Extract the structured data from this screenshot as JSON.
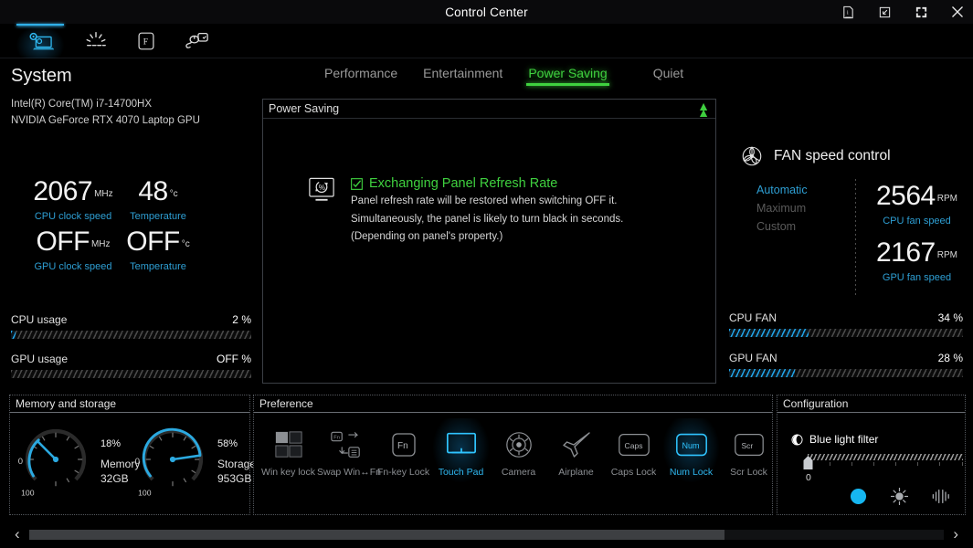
{
  "titlebar": {
    "title": "Control Center",
    "buttons": [
      {
        "name": "info-icon",
        "label": "Info"
      },
      {
        "name": "minimize-to-tray-icon",
        "label": "Minimize"
      },
      {
        "name": "fullscreen-icon",
        "label": "Fullscreen"
      },
      {
        "name": "close-icon",
        "label": "Close"
      }
    ]
  },
  "nav": {
    "items": [
      {
        "name": "system-settings-icon",
        "label": "System",
        "active": true
      },
      {
        "name": "keyboard-backlight-icon",
        "label": "Lighting",
        "active": false
      },
      {
        "name": "fn-key-icon",
        "label": "Fn Key",
        "active": false
      },
      {
        "name": "mouse-device-icon",
        "label": "Device",
        "active": false
      }
    ]
  },
  "system": {
    "title": "System",
    "cpu_name": "Intel(R) Core(TM) i7-14700HX",
    "gpu_name": "NVIDIA GeForce RTX 4070 Laptop GPU",
    "stats": [
      {
        "value": "2067",
        "unit": "MHz",
        "label": "CPU clock speed"
      },
      {
        "value": "48",
        "unit": "°c",
        "label": "Temperature"
      },
      {
        "value": "OFF",
        "unit": "MHz",
        "label": "GPU clock speed"
      },
      {
        "value": "OFF",
        "unit": "°c",
        "label": "Temperature"
      }
    ],
    "usage": [
      {
        "label": "CPU usage",
        "value": "2",
        "unit": "%",
        "percent": 2
      },
      {
        "label": "GPU usage",
        "value": "OFF",
        "unit": "%",
        "percent": 0
      }
    ]
  },
  "modes": {
    "tabs": [
      {
        "label": "Performance",
        "active": false
      },
      {
        "label": "Entertainment",
        "active": false
      },
      {
        "label": "Power Saving",
        "active": true
      },
      {
        "label": "Quiet",
        "active": false
      }
    ],
    "active_color": "#3fd13f"
  },
  "power_saving_panel": {
    "header": "Power Saving",
    "collapse_icon": "chevron-up-double-icon",
    "feature": {
      "icon": "panel-refresh-rate-icon",
      "checkbox": "checked",
      "title": "Exchanging Panel Refresh Rate",
      "description_lines": [
        "Panel refresh rate will be restored when switching OFF it.",
        "Simultaneously, the panel is likely to turn black in seconds.",
        "(Depending on panel's property.)"
      ]
    }
  },
  "fan": {
    "title": "FAN speed control",
    "icon": "fan-icon",
    "modes": [
      {
        "label": "Automatic",
        "selected": true
      },
      {
        "label": "Maximum",
        "selected": false
      },
      {
        "label": "Custom",
        "selected": false
      }
    ],
    "readouts": [
      {
        "value": "2564",
        "unit": "RPM",
        "label": "CPU fan speed"
      },
      {
        "value": "2167",
        "unit": "RPM",
        "label": "GPU fan speed"
      }
    ],
    "bars": [
      {
        "label": "CPU FAN",
        "value": "34",
        "unit": "%",
        "percent": 34
      },
      {
        "label": "GPU FAN",
        "value": "28",
        "unit": "%",
        "percent": 28
      }
    ]
  },
  "memory_storage": {
    "header": "Memory and storage",
    "gauges": [
      {
        "percent": 18,
        "pct_text": "18",
        "pct_unit": "%",
        "name": "Memory",
        "capacity": "32GB",
        "min_label": "0",
        "max_label": "100"
      },
      {
        "percent": 58,
        "pct_text": "58",
        "pct_unit": "%",
        "name": "Storage",
        "capacity": "953GB",
        "min_label": "0",
        "max_label": "100"
      }
    ]
  },
  "preference": {
    "header": "Preference",
    "items": [
      {
        "label": "Win key lock",
        "icon": "win-key-lock-icon",
        "active": false
      },
      {
        "label": "Swap Win↔Fn",
        "icon": "swap-win-fn-icon",
        "active": false
      },
      {
        "label": "Fn-key Lock",
        "icon": "fn-key-lock-icon",
        "active": false
      },
      {
        "label": "Touch Pad",
        "icon": "touchpad-icon",
        "active": true
      },
      {
        "label": "Camera",
        "icon": "camera-icon",
        "active": false
      },
      {
        "label": "Airplane",
        "icon": "airplane-icon",
        "active": false
      },
      {
        "label": "Caps Lock",
        "icon": "caps-lock-icon",
        "active": false
      },
      {
        "label": "Num Lock",
        "icon": "num-lock-icon",
        "active": true
      },
      {
        "label": "Scr Lock",
        "icon": "scroll-lock-icon",
        "active": false
      }
    ]
  },
  "configuration": {
    "header": "Configuration",
    "blue_light_filter": {
      "icon": "moon-icon",
      "label": "Blue light filter",
      "value": "0",
      "percent": 0
    },
    "display_modes": [
      {
        "icon": "moon-filter-icon",
        "active": true
      },
      {
        "icon": "brightness-split-icon",
        "active": false
      },
      {
        "icon": "contrast-wave-icon",
        "active": false
      }
    ]
  },
  "scrollbar": {
    "left_arrow": "‹",
    "right_arrow": "›",
    "thumb_percent": 76
  },
  "colors": {
    "accent_blue": "#2e9fd4",
    "accent_cyan": "#2fb7ef",
    "accent_green": "#3fd13f",
    "background": "#000000"
  }
}
